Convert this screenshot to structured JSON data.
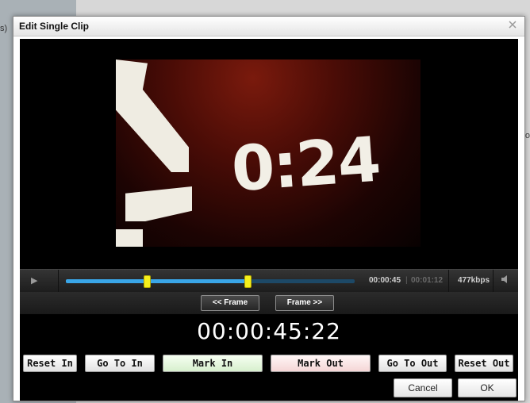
{
  "background": {
    "left_fragment": "s)",
    "right_fragment": "o"
  },
  "dialog": {
    "title": "Edit Single Clip",
    "close_icon": "close-icon"
  },
  "video": {
    "countdown_text": "0:24"
  },
  "player_controls": {
    "play_icon": "play-icon",
    "current_time": "00:00:45",
    "time_separator": "|",
    "total_time": "00:01:12",
    "bitrate": "477kbps",
    "volume_icon": "volume-icon",
    "in_marker_fraction": 0.28,
    "out_marker_fraction": 0.63,
    "colors": {
      "track": "#1d4967",
      "fill": "#3aa6e8",
      "marker": "#f5ef1c"
    }
  },
  "frame_nav": {
    "prev_label": "<< Frame",
    "next_label": "Frame >>"
  },
  "timecode": "00:00:45:22",
  "clip_buttons": {
    "reset_in": "Reset In",
    "go_to_in": "Go To In",
    "mark_in": "Mark In",
    "mark_out": "Mark Out",
    "go_to_out": "Go To Out",
    "reset_out": "Reset Out"
  },
  "footer": {
    "cancel_label": "Cancel",
    "ok_label": "OK"
  }
}
